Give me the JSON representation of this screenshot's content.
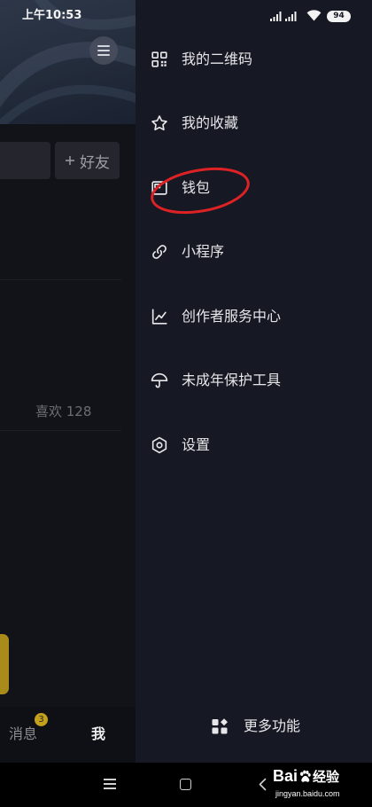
{
  "status_bar": {
    "time": "上午10:53",
    "battery_level": "94"
  },
  "profile": {
    "add_friend_label": "好友",
    "likes_label": "喜欢 128"
  },
  "bottom_nav": {
    "messages_label": "消息",
    "messages_badge": "3",
    "me_label": "我"
  },
  "drawer": {
    "items": [
      {
        "label": "我的二维码",
        "icon": "qr-code-icon"
      },
      {
        "label": "我的收藏",
        "icon": "star-icon"
      },
      {
        "label": "钱包",
        "icon": "wallet-icon"
      },
      {
        "label": "小程序",
        "icon": "link-icon"
      },
      {
        "label": "创作者服务中心",
        "icon": "chart-icon"
      },
      {
        "label": "未成年保护工具",
        "icon": "umbrella-icon"
      },
      {
        "label": "设置",
        "icon": "settings-icon"
      }
    ],
    "more_label": "更多功能",
    "more_icon": "grid-more-icon"
  },
  "watermark": {
    "brand_prefix": "Bai",
    "brand_suffix": "经验",
    "url": "jingyan.baidu.com"
  },
  "colors": {
    "drawer_bg": "#161823",
    "accent_yellow": "#c4a11d",
    "annotation_red": "#dc2224",
    "text_primary": "#e7e7e9"
  }
}
